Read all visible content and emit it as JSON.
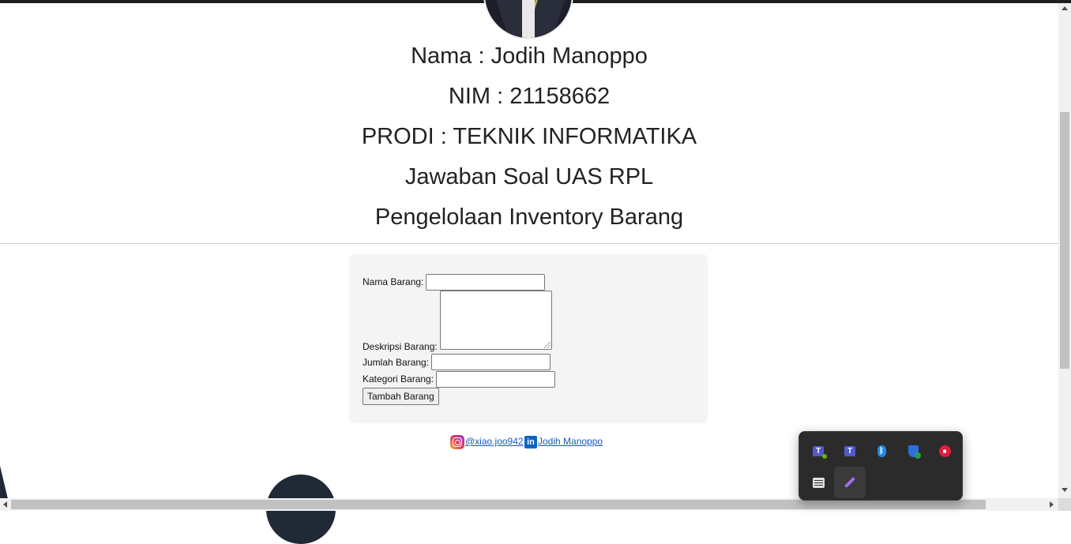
{
  "header": {
    "name_line": "Nama : Jodih Manoppo",
    "nim_line": "NIM : 21158662",
    "prodi_line": "PRODI : TEKNIK INFORMATIKA",
    "title_line": "Jawaban Soal UAS RPL",
    "subtitle_line": "Pengelolaan Inventory Barang"
  },
  "form": {
    "nama_label": "Nama Barang:",
    "nama_value": "",
    "deskripsi_label": "Deskripsi Barang:",
    "deskripsi_value": "",
    "jumlah_label": "Jumlah Barang:",
    "jumlah_value": "",
    "kategori_label": "Kategori Barang:",
    "kategori_value": "",
    "submit_label": "Tambah Barang"
  },
  "footer": {
    "instagram_text": "@xiao.joo942",
    "linkedin_text": " Jodih Manoppo",
    "instagram_icon": "instagram-icon",
    "linkedin_icon": "linkedin-icon",
    "linkedin_glyph": "in"
  },
  "tray": {
    "icons": [
      "teams-icon",
      "teams-icon",
      "bluetooth-icon",
      "security-shield-icon",
      "red-app-icon",
      "panel-settings-icon",
      "feather-app-icon"
    ],
    "teams_glyph": "T",
    "bluetooth_glyph": "ᛒ",
    "red_glyph": "■"
  },
  "colors": {
    "link": "#1a56c9",
    "tray_bg": "#2b2b2b",
    "form_bg": "#f4f4f4"
  }
}
